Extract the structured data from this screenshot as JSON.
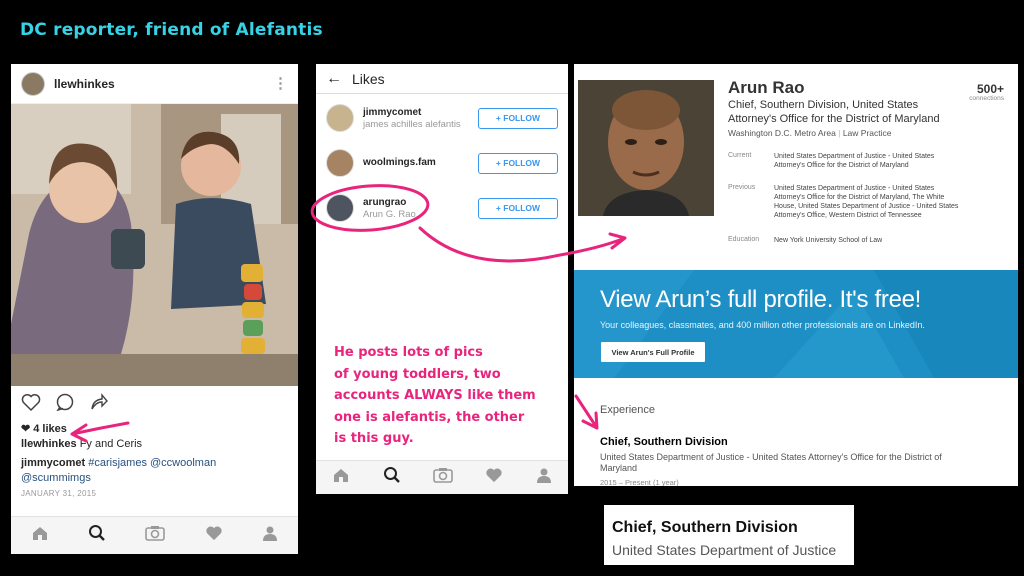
{
  "slide": {
    "title": "DC reporter, friend of Alefantis"
  },
  "post": {
    "username": "llewhinkes",
    "likes": "4 likes",
    "caption_user": "llewhinkes",
    "caption_text": "Fy and Ceris",
    "comment_user": "jimmycomet",
    "comment_tags": "#carisjames @ccwoolman",
    "comment_tags2": "@scummimgs",
    "date": "JANUARY 31, 2015"
  },
  "likes_panel": {
    "title": "Likes",
    "users": [
      {
        "username": "jimmycomet",
        "fullname": "james achilles alefantis",
        "button": "+ FOLLOW"
      },
      {
        "username": "woolmings.fam",
        "fullname": "",
        "button": "+ FOLLOW"
      },
      {
        "username": "arungrao",
        "fullname": "Arun G. Rao",
        "button": "+ FOLLOW"
      }
    ]
  },
  "annotation": {
    "line1": "He posts lots of pics",
    "line2": "of young toddlers, two",
    "line3": "accounts ALWAYS like them",
    "line4": "one is alefantis, the other",
    "line5": "is this guy."
  },
  "linkedin": {
    "name": "Arun Rao",
    "headline": "Chief, Southern Division, United States Attorney's Office for the District of Maryland",
    "location": "Washington D.C. Metro Area",
    "industry": "Law Practice",
    "connections": "500+",
    "connections_label": "connections",
    "current_label": "Current",
    "current_value": "United States Department of Justice - United States Attorney's Office for the District of Maryland",
    "previous_label": "Previous",
    "previous_value": "United States Department of Justice - United States Attorney's Office for the District of Maryland, The White House, United States Department of Justice - United States Attorney's Office, Western District of Tennessee",
    "education_label": "Education",
    "education_value": "New York University School of Law",
    "banner_title": "View Arun’s full profile. It's free!",
    "banner_subtitle": "Your colleagues, classmates, and 400 million other professionals are on LinkedIn.",
    "banner_button": "View Arun's Full Profile",
    "experience_header": "Experience",
    "exp_title": "Chief, Southern Division",
    "exp_org": "United States Department of Justice - United States Attorney's Office for the District of Maryland",
    "exp_dates": "2015 – Present (1 year)"
  },
  "zoom": {
    "title": "Chief, Southern Division",
    "org": "United States Department of Justice"
  },
  "colors": {
    "annotation": "#e8247d",
    "title": "#36d3e6",
    "linkedin_blue": "#1e8fc4",
    "follow_blue": "#3897f0"
  }
}
